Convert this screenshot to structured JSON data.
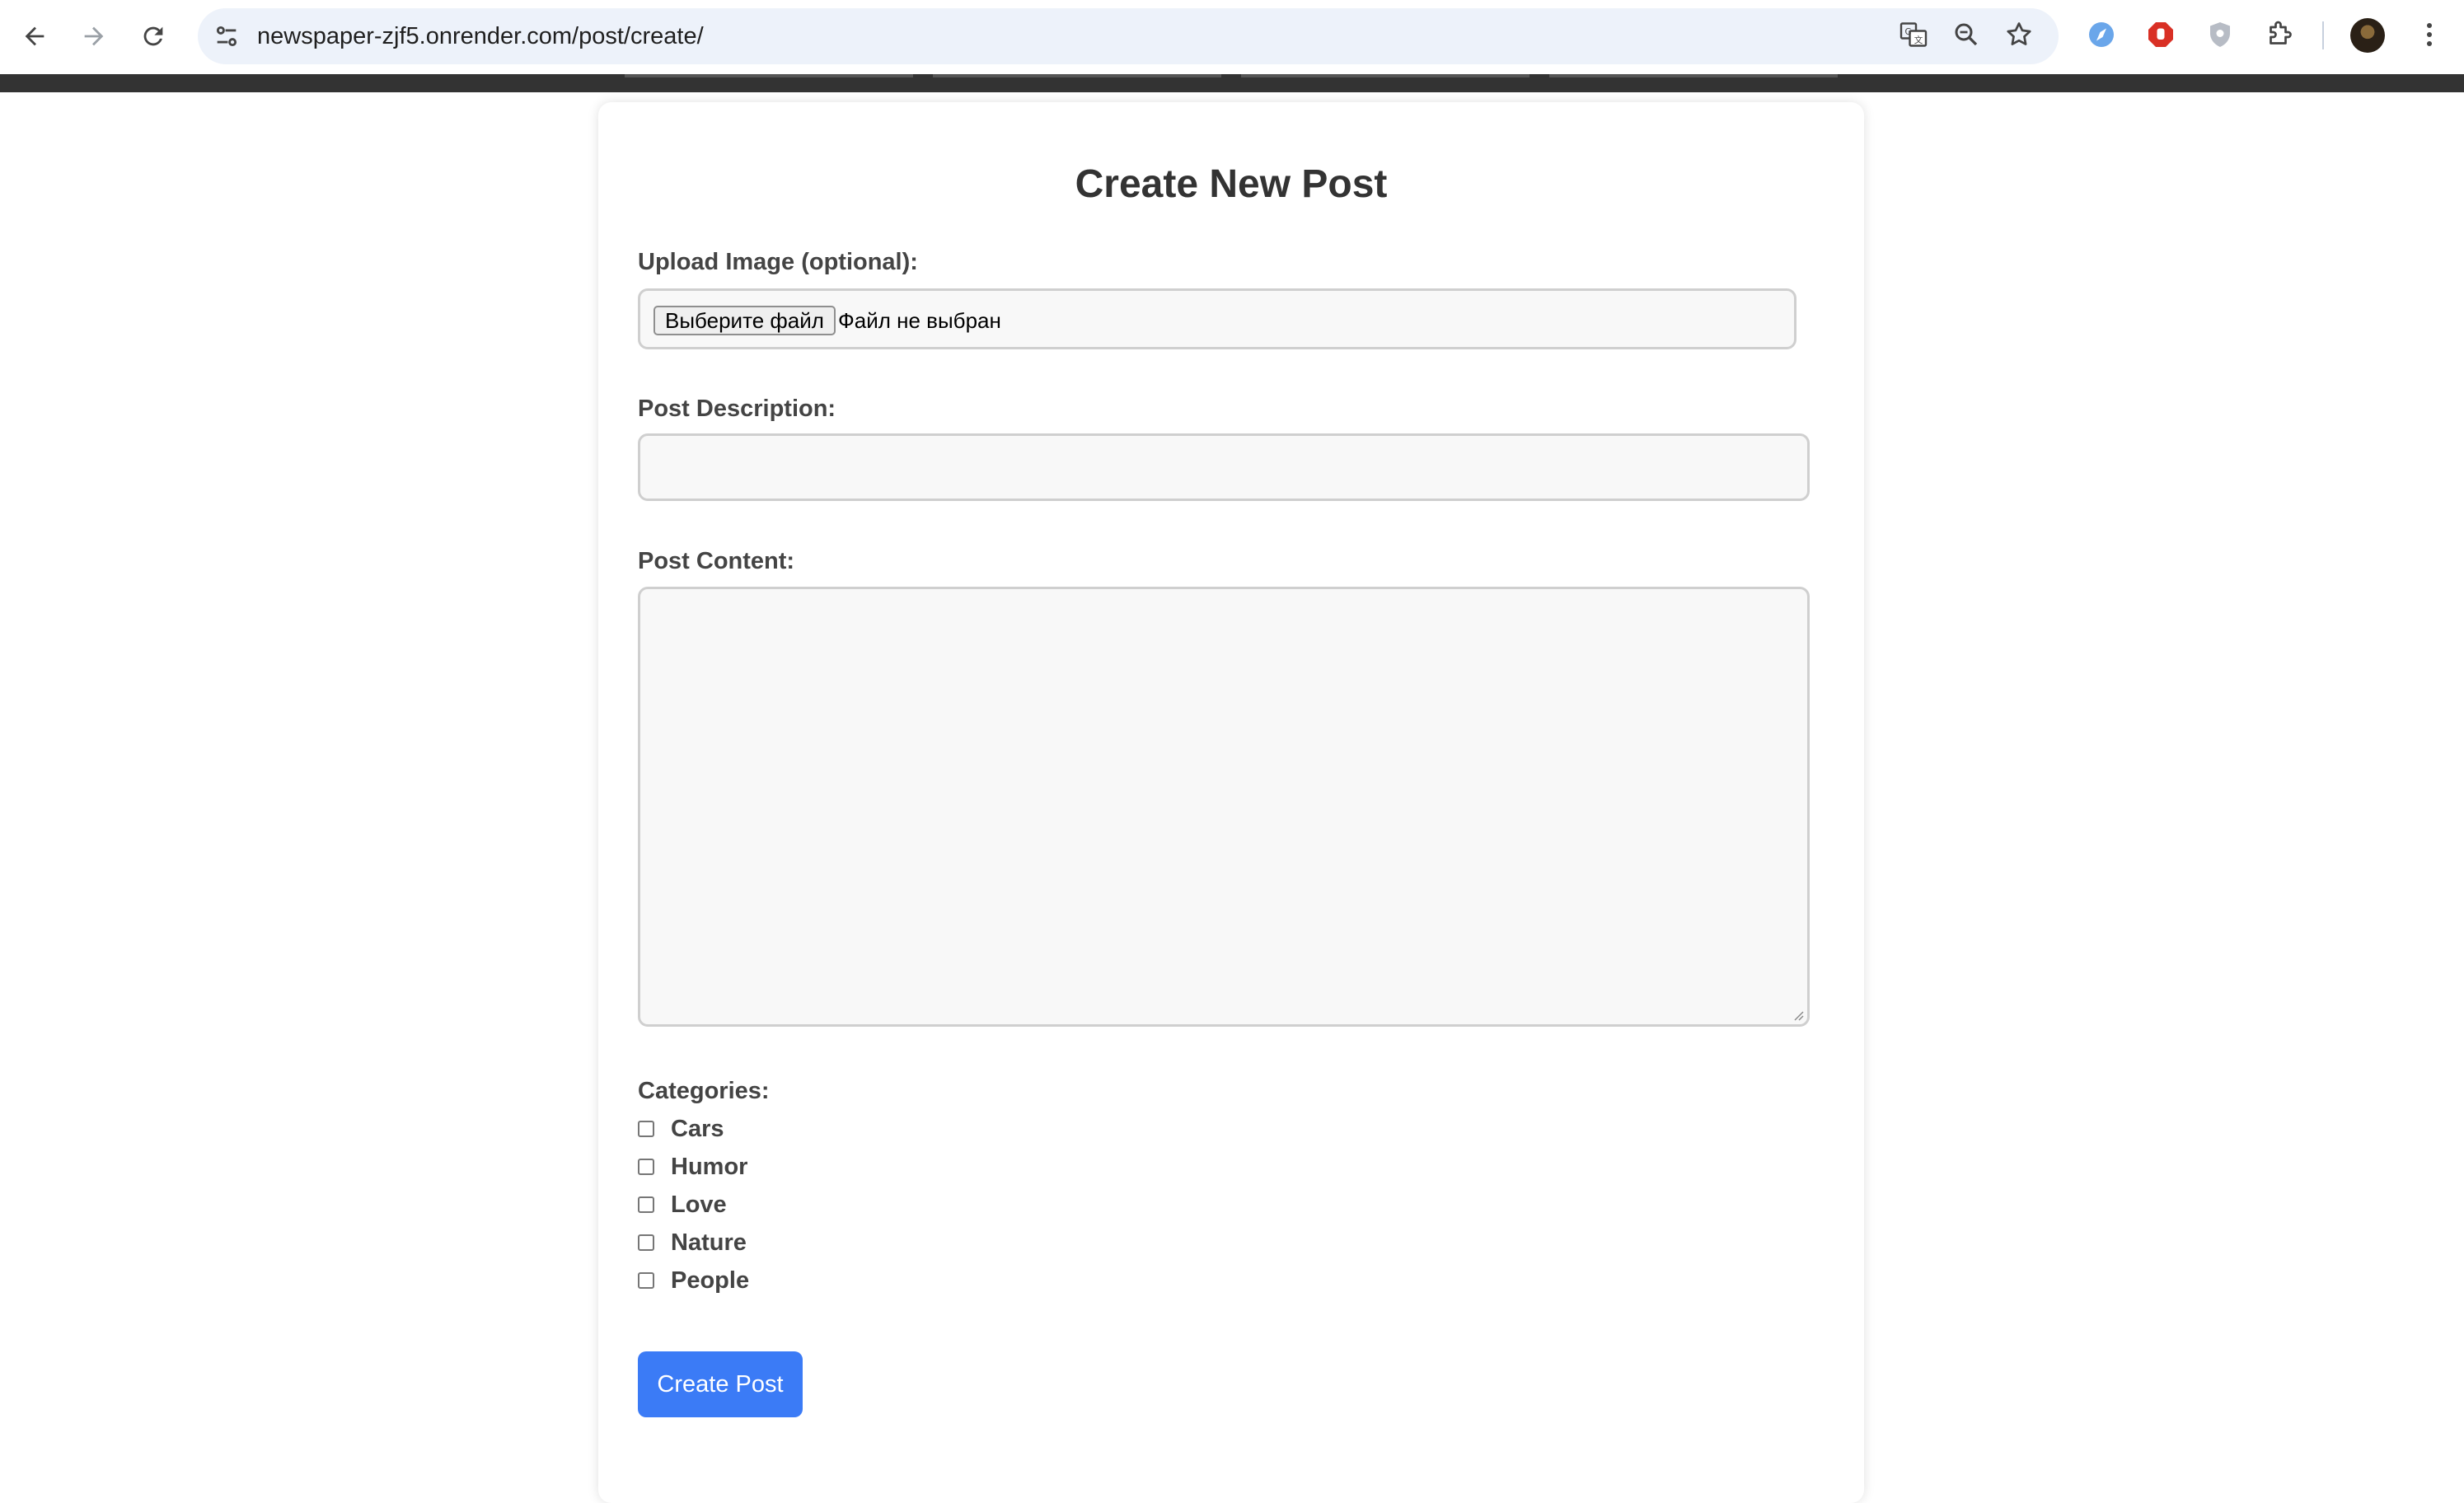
{
  "browser": {
    "url": "newspaper-zjf5.onrender.com/post/create/"
  },
  "form": {
    "title": "Create New Post",
    "upload_label": "Upload Image (optional):",
    "file_button_label": "Выберите файл",
    "file_status": "Файл не выбран",
    "description_label": "Post Description:",
    "description_value": "",
    "content_label": "Post Content:",
    "content_value": "",
    "categories_label": "Categories:",
    "categories": [
      {
        "label": "Cars",
        "checked": false
      },
      {
        "label": "Humor",
        "checked": false
      },
      {
        "label": "Love",
        "checked": false
      },
      {
        "label": "Nature",
        "checked": false
      },
      {
        "label": "People",
        "checked": false
      }
    ],
    "submit_label": "Create Post"
  },
  "colors": {
    "accent": "#3b7bf6",
    "navbar": "#333333",
    "omnibox": "#edf2fa"
  }
}
